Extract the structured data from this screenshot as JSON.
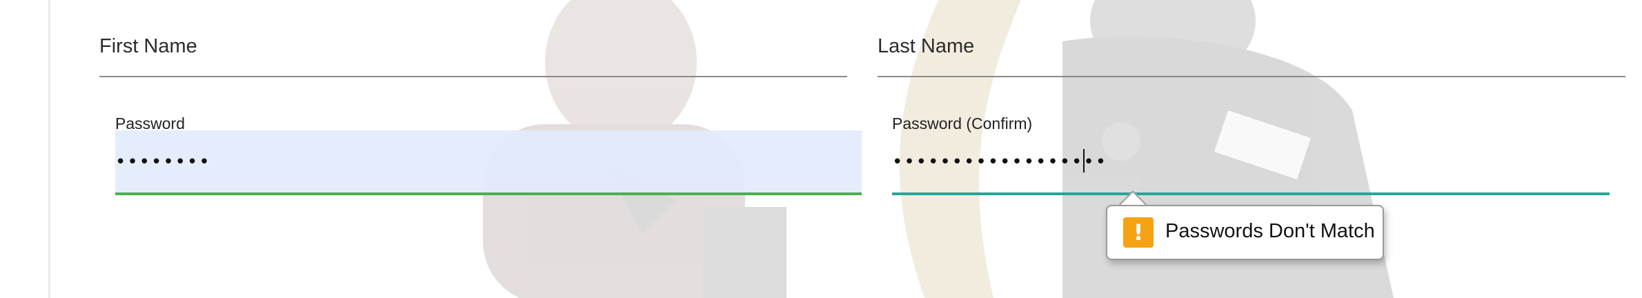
{
  "form": {
    "first_name_label": "First Name",
    "last_name_label": "Last Name",
    "password_label": "Password",
    "password_value": "••••••••",
    "password_confirm_label": "Password (Confirm)",
    "password_confirm_value": "••••••••••••••••••"
  },
  "validation": {
    "message": "Passwords Don't Match",
    "icon": "!",
    "icon_name": "warning-icon",
    "icon_color": "#f6a313"
  },
  "colors": {
    "password_valid_bar": "#4caf50",
    "password_confirm_bar": "#26a69a",
    "password_autofill_bg": "#e2ebfc"
  }
}
